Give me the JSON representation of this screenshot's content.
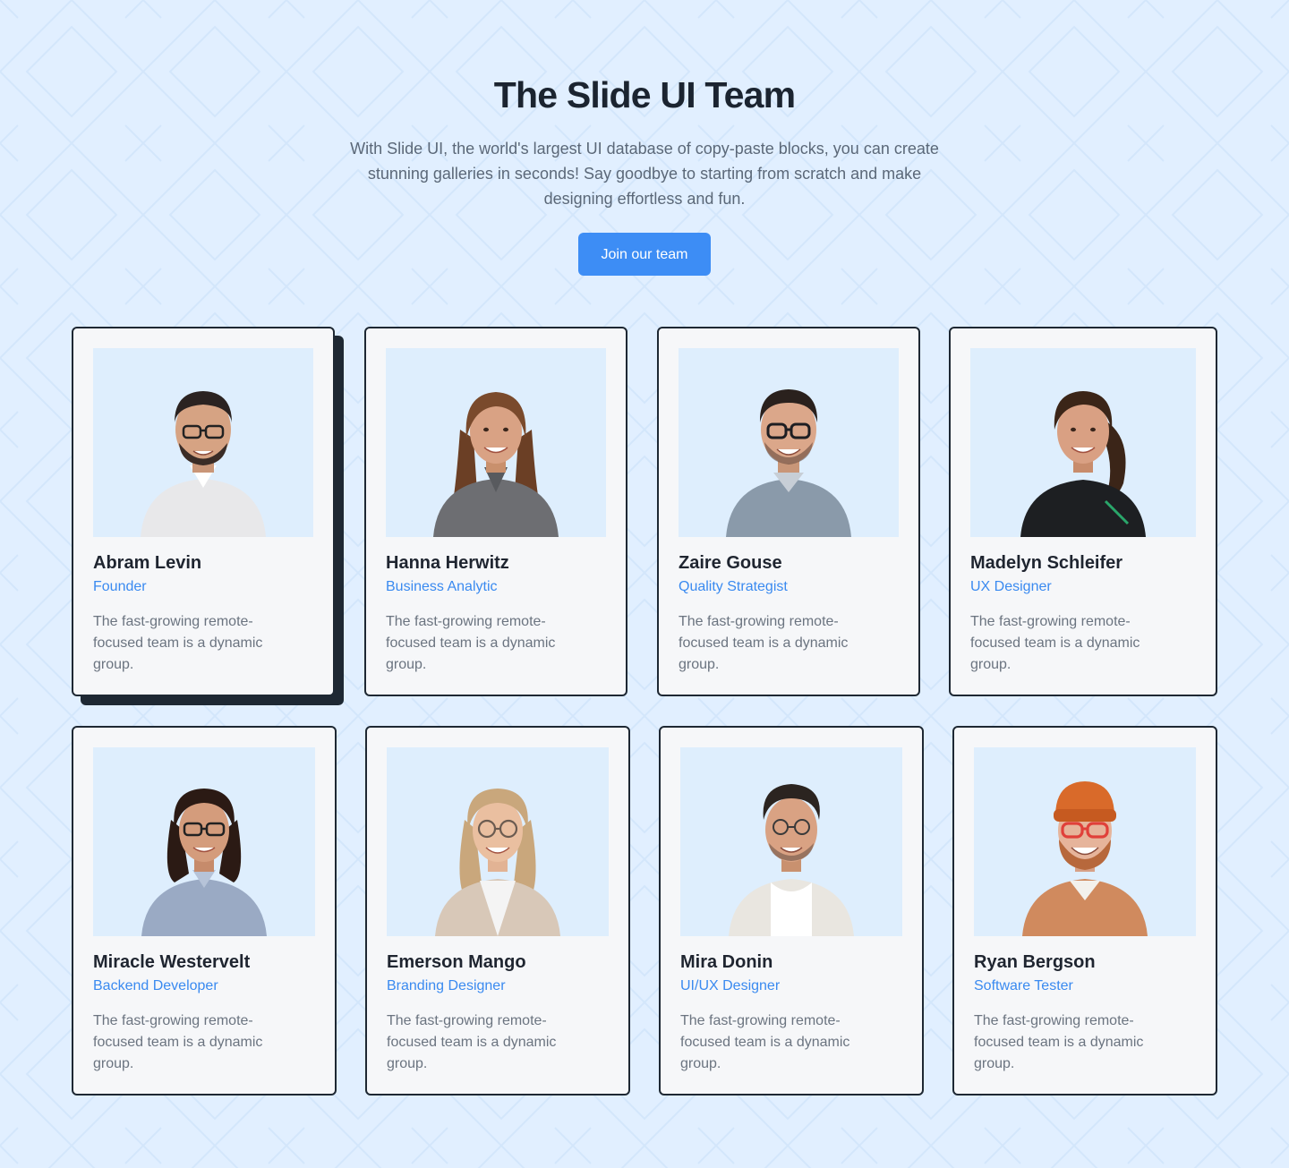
{
  "header": {
    "title": "The Slide UI Team",
    "description": "With Slide UI, the world's largest UI database of copy-paste blocks, you can create stunning galleries in seconds! Say goodbye to starting from scratch and make designing effortless and fun.",
    "cta_label": "Join our team"
  },
  "colors": {
    "background": "#e1efff",
    "accent": "#3d8df5",
    "role_text": "#3a8af0",
    "card_border": "#1e2833",
    "card_background": "#f6f7f9",
    "photo_background": "#deeefd"
  },
  "team": [
    {
      "name": "Abram Levin",
      "role": "Founder",
      "bio": "The fast-growing remote-focused team is a dynamic group.",
      "photo": "man-with-glasses-portrait"
    },
    {
      "name": "Hanna Herwitz",
      "role": "Business Analytic",
      "bio": "The fast-growing remote-focused team is a dynamic group.",
      "photo": "woman-portrait"
    },
    {
      "name": "Zaire Gouse",
      "role": "Quality Strategist",
      "bio": "The fast-growing remote-focused team is a dynamic group.",
      "photo": "man-with-glasses-portrait"
    },
    {
      "name": "Madelyn Schleifer",
      "role": "UX Designer",
      "bio": "The fast-growing remote-focused team is a dynamic group.",
      "photo": "woman-portrait"
    },
    {
      "name": "Miracle Westervelt",
      "role": "Backend Developer",
      "bio": "The fast-growing remote-focused team is a dynamic group.",
      "photo": "woman-with-glasses-portrait"
    },
    {
      "name": "Emerson Mango",
      "role": "Branding Designer",
      "bio": "The fast-growing remote-focused team is a dynamic group.",
      "photo": "woman-with-glasses-portrait"
    },
    {
      "name": "Mira Donin",
      "role": "UI/UX Designer",
      "bio": "The fast-growing remote-focused team is a dynamic group.",
      "photo": "man-with-glasses-portrait"
    },
    {
      "name": "Ryan Bergson",
      "role": "Software Tester",
      "bio": "The fast-growing remote-focused team is a dynamic group.",
      "photo": "man-with-beanie-and-glasses-portrait"
    }
  ]
}
